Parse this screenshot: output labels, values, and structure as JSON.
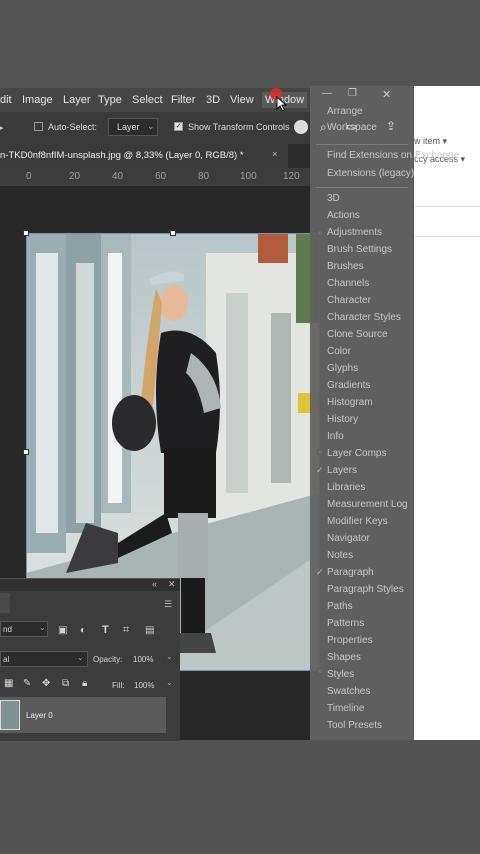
{
  "menubar": {
    "items": [
      "dit",
      "Image",
      "Layer",
      "Type",
      "Select",
      "Filter",
      "3D",
      "View",
      "Window"
    ]
  },
  "options": {
    "auto_select": "Auto-Select:",
    "auto_select_value": "Layer",
    "show_transform": "Show Transform Controls"
  },
  "document_tab": {
    "title": "n-TKD0nf8nfIM-unsplash.jpg @ 8,33% (Layer 0, RGB/8) *",
    "close": "×"
  },
  "ruler": {
    "ticks": [
      "0",
      "20",
      "40",
      "60",
      "80",
      "100",
      "120"
    ]
  },
  "layers_panel": {
    "blend_mode": "nd",
    "lock_row": "al",
    "opacity_label": "Opacity:",
    "opacity_value": "100%",
    "fill_label": "Fill:",
    "fill_value": "100%",
    "layer_name": "Layer 0"
  },
  "window_menu": {
    "items": [
      {
        "label": "Arrange",
        "checked": false
      },
      {
        "label": "Workspace",
        "checked": false
      },
      {
        "label": "Find Extensions on Exchange",
        "checked": false
      },
      {
        "label": "Extensions (legacy)",
        "checked": false
      },
      {
        "label": "3D",
        "checked": false
      },
      {
        "label": "Actions",
        "checked": false
      },
      {
        "label": "Adjustments",
        "checked": false
      },
      {
        "label": "Brush Settings",
        "checked": false
      },
      {
        "label": "Brushes",
        "checked": false
      },
      {
        "label": "Channels",
        "checked": false
      },
      {
        "label": "Character",
        "checked": false
      },
      {
        "label": "Character Styles",
        "checked": false
      },
      {
        "label": "Clone Source",
        "checked": false
      },
      {
        "label": "Color",
        "checked": false
      },
      {
        "label": "Glyphs",
        "checked": false
      },
      {
        "label": "Gradients",
        "checked": false
      },
      {
        "label": "Histogram",
        "checked": false
      },
      {
        "label": "History",
        "checked": false
      },
      {
        "label": "Info",
        "checked": false
      },
      {
        "label": "Layer Comps",
        "checked": false
      },
      {
        "label": "Layers",
        "checked": true
      },
      {
        "label": "Libraries",
        "checked": false
      },
      {
        "label": "Measurement Log",
        "checked": false
      },
      {
        "label": "Modifier Keys",
        "checked": false
      },
      {
        "label": "Navigator",
        "checked": false
      },
      {
        "label": "Notes",
        "checked": false
      },
      {
        "label": "Paragraph",
        "checked": true
      },
      {
        "label": "Paragraph Styles",
        "checked": false
      },
      {
        "label": "Paths",
        "checked": false
      },
      {
        "label": "Patterns",
        "checked": false
      },
      {
        "label": "Properties",
        "checked": false
      },
      {
        "label": "Shapes",
        "checked": false
      },
      {
        "label": "Styles",
        "checked": false
      },
      {
        "label": "Swatches",
        "checked": false
      },
      {
        "label": "Timeline",
        "checked": false
      },
      {
        "label": "Tool Presets",
        "checked": false
      }
    ]
  },
  "window_controls": {
    "minimize": "—",
    "restore": "❐",
    "close": "✕"
  },
  "side_panel": {
    "new_item": "w item ▾",
    "quick_access": "ccy access ▾"
  },
  "colors": {
    "menubar_bg": "#464646",
    "canvas_bg": "#282828",
    "selection_handle": "#ffffff",
    "click_marker": "#d8322b"
  }
}
